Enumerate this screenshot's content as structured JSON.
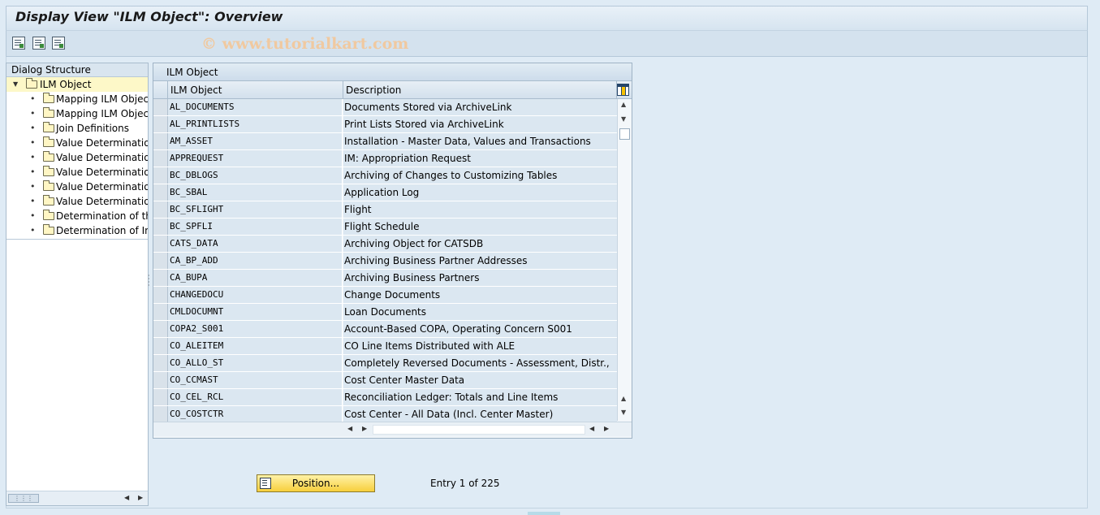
{
  "window": {
    "title": "Display View \"ILM Object\": Overview",
    "watermark": "© www.tutorialkart.com"
  },
  "toolbar": {
    "buttons": [
      {
        "icon": "details-icon"
      },
      {
        "icon": "export-icon"
      },
      {
        "icon": "print-icon"
      }
    ]
  },
  "dialog_structure": {
    "header": "Dialog Structure",
    "root": {
      "label": "ILM Object",
      "icon": "folder-open-icon",
      "expander": "▼"
    },
    "items": [
      "Mapping ILM Object",
      "Mapping ILM Object",
      "Join Definitions",
      "Value Determination",
      "Value Determination",
      "Value Determination",
      "Value Determination",
      "Value Determination",
      "Determination of the",
      "Determination of Inh"
    ],
    "bullet": "•",
    "scroll_thumb": "⋮⋮⋮"
  },
  "table": {
    "title": "ILM Object",
    "columns": [
      "ILM Object",
      "Description"
    ],
    "rows": [
      [
        "AL_DOCUMENTS",
        "Documents Stored via ArchiveLink"
      ],
      [
        "AL_PRINTLISTS",
        "Print Lists Stored via ArchiveLink"
      ],
      [
        "AM_ASSET",
        "Installation - Master Data, Values and Transactions"
      ],
      [
        "APPREQUEST",
        "IM: Appropriation Request"
      ],
      [
        "BC_DBLOGS",
        "Archiving of Changes to Customizing Tables"
      ],
      [
        "BC_SBAL",
        "Application Log"
      ],
      [
        "BC_SFLIGHT",
        "Flight"
      ],
      [
        "BC_SPFLI",
        "Flight Schedule"
      ],
      [
        "CATS_DATA",
        "Archiving Object for CATSDB"
      ],
      [
        "CA_BP_ADD",
        "Archiving Business Partner Addresses"
      ],
      [
        "CA_BUPA",
        "Archiving Business Partners"
      ],
      [
        "CHANGEDOCU",
        "Change Documents"
      ],
      [
        "CMLDOCUMNT",
        "Loan Documents"
      ],
      [
        "COPA2_S001",
        "Account-Based COPA, Operating Concern S001"
      ],
      [
        "CO_ALEITEM",
        "CO Line Items Distributed with ALE"
      ],
      [
        "CO_ALLO_ST",
        "Completely Reversed Documents - Assessment, Distr.,"
      ],
      [
        "CO_CCMAST",
        "Cost Center Master Data"
      ],
      [
        "CO_CEL_RCL",
        "Reconciliation Ledger: Totals and Line Items"
      ],
      [
        "CO_COSTCTR",
        "Cost Center - All Data (Incl. Center Master)"
      ]
    ]
  },
  "footer": {
    "position_button": "Position...",
    "entry_text": "Entry 1 of 225"
  },
  "colors": {
    "background": "#dfebf5",
    "row_bg": "#dbe7f1",
    "button_yellow": "#f7cf3c"
  }
}
